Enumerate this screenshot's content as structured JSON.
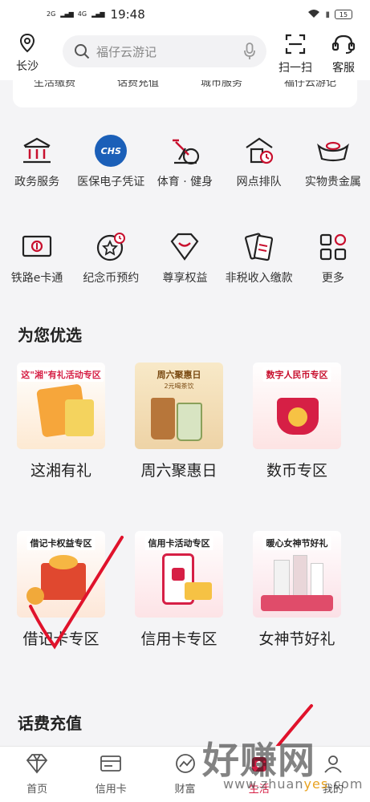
{
  "status": {
    "signal_1": "2G",
    "signal_2": "4G",
    "time": "19:48",
    "battery": "15"
  },
  "header": {
    "location": "长沙",
    "search_placeholder": "福仔云游记",
    "scan_label": "扫一扫",
    "service_label": "客服"
  },
  "top_shortcuts": [
    "生活缴费",
    "话费充值",
    "城市服务",
    "福仔云游记"
  ],
  "services_row1": [
    {
      "label": "政务服务",
      "icon": "government-icon"
    },
    {
      "label": "医保电子凭证",
      "icon": "chs-medical-insurance-icon",
      "badge": "CHS"
    },
    {
      "label": "体育 · 健身",
      "icon": "exercise-bike-icon"
    },
    {
      "label": "网点排队",
      "icon": "branch-queue-icon"
    },
    {
      "label": "实物贵金属",
      "icon": "gold-ingot-icon"
    }
  ],
  "services_row2": [
    {
      "label": "铁路e卡通",
      "icon": "railway-card-icon"
    },
    {
      "label": "纪念币预约",
      "icon": "commemorative-coin-icon"
    },
    {
      "label": "尊享权益",
      "icon": "privilege-icon"
    },
    {
      "label": "非税收入缴款",
      "icon": "non-tax-payment-icon"
    },
    {
      "label": "更多",
      "icon": "more-grid-icon"
    }
  ],
  "recommend": {
    "title": "为您优选",
    "items": [
      {
        "tag": "这\"湘\"有礼活动专区",
        "name": "这湘有礼"
      },
      {
        "tag": "周六聚惠日",
        "sub": "2元喝茶饮",
        "name": "周六聚惠日"
      },
      {
        "tag": "数字人民币专区",
        "name": "数币专区"
      },
      {
        "tag": "借记卡权益专区",
        "name": "借记卡专区"
      },
      {
        "tag": "信用卡活动专区",
        "name": "信用卡专区"
      },
      {
        "tag": "暖心女神节好礼",
        "name": "女神节好礼"
      }
    ]
  },
  "topup": {
    "title": "话费充值"
  },
  "tabbar": [
    {
      "label": "首页",
      "icon": "diamond-icon"
    },
    {
      "label": "信用卡",
      "icon": "credit-card-icon"
    },
    {
      "label": "财富",
      "icon": "wealth-chart-icon"
    },
    {
      "label": "生活",
      "icon": "life-icon",
      "active": true
    },
    {
      "label": "我的",
      "icon": "user-icon"
    }
  ],
  "watermark": {
    "text": "好赚网",
    "url_prefix": "www.zhuan",
    "url_highlight": "yes",
    "url_suffix": ".com"
  },
  "colors": {
    "accent": "#d61f45",
    "icon_red": "#c8102e",
    "annotation_red": "#e0122b"
  }
}
